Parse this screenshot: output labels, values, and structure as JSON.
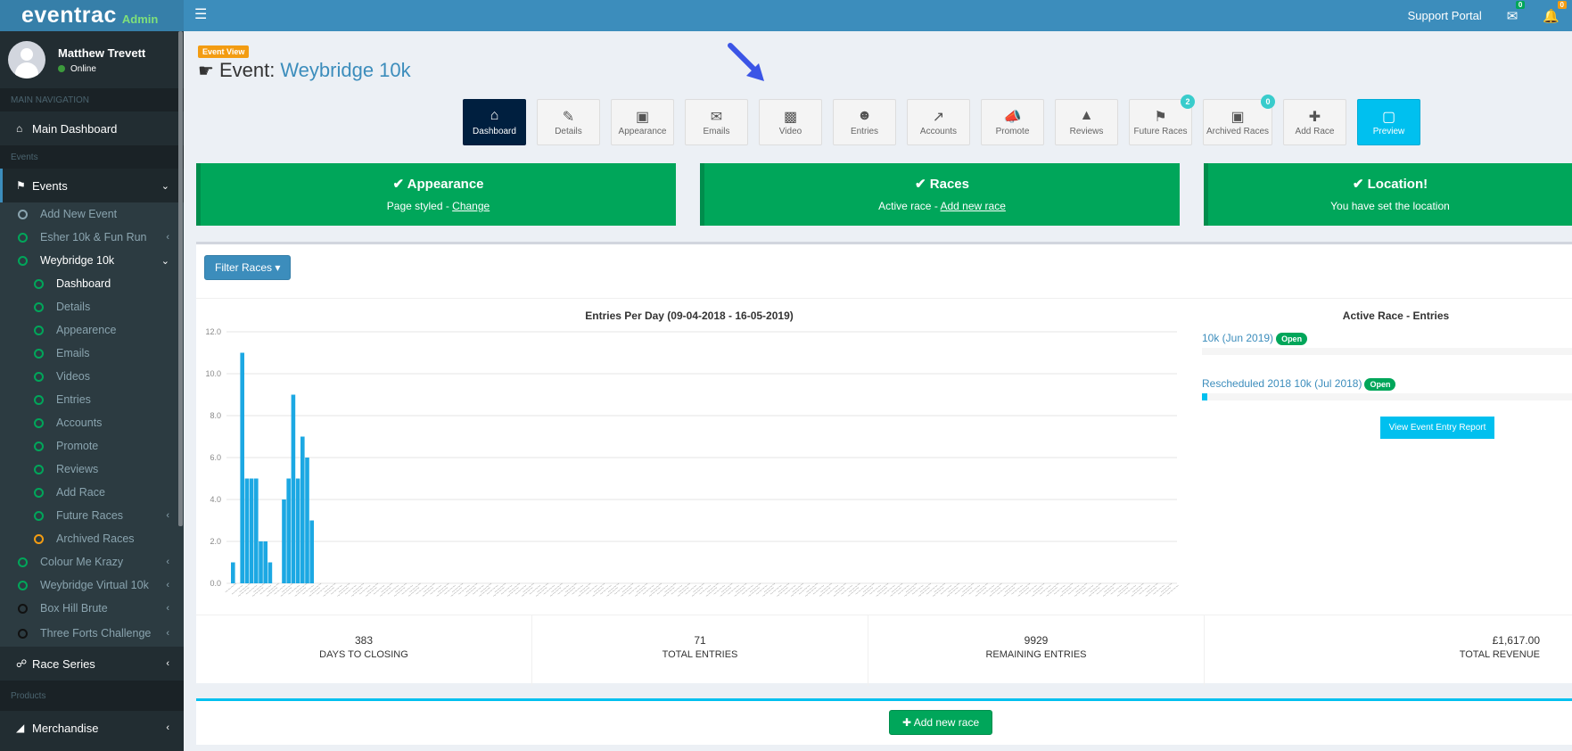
{
  "topbar": {
    "brand": "eventrac",
    "brand_suffix": "Admin",
    "menu_icon": "hamburger-icon",
    "support_label": "Support Portal",
    "messages_count": "0",
    "notifications_count": "0",
    "colors": {
      "topbar": "#3c8dbc",
      "msg_badge": "#00a65a",
      "notif_badge": "#f39c12"
    }
  },
  "user": {
    "name": "Matthew Trevett",
    "status": "Online"
  },
  "sidebar": {
    "main_nav_header": "MAIN NAVIGATION",
    "main_dashboard": "Main Dashboard",
    "events_header": "Events",
    "events": "Events",
    "add_new_event": "Add New Event",
    "event_items": [
      {
        "label": "Esher 10k & Fun Run",
        "status": "green"
      },
      {
        "label": "Weybridge 10k",
        "status": "green"
      }
    ],
    "weybridge_sub": [
      {
        "label": "Dashboard",
        "ring": "green"
      },
      {
        "label": "Details",
        "ring": "green"
      },
      {
        "label": "Appearence",
        "ring": "green"
      },
      {
        "label": "Emails",
        "ring": "green"
      },
      {
        "label": "Videos",
        "ring": "green"
      },
      {
        "label": "Entries",
        "ring": "green"
      },
      {
        "label": "Accounts",
        "ring": "green"
      },
      {
        "label": "Promote",
        "ring": "green"
      },
      {
        "label": "Reviews",
        "ring": "green"
      },
      {
        "label": "Add Race",
        "ring": "green"
      },
      {
        "label": "Future Races",
        "ring": "green"
      },
      {
        "label": "Archived Races",
        "ring": "orange"
      }
    ],
    "other_events": [
      {
        "label": "Colour Me Krazy",
        "ring": "green"
      },
      {
        "label": "Weybridge Virtual 10k",
        "ring": "green"
      },
      {
        "label": "Box Hill Brute",
        "ring": "black"
      },
      {
        "label": "Three Forts Challenge",
        "ring": "black"
      }
    ],
    "race_series": "Race Series",
    "products_header": "Products",
    "merchandise": "Merchandise"
  },
  "page": {
    "badge": "Event View",
    "title_prefix": "Event:",
    "event_name": "Weybridge 10k"
  },
  "toolbar": [
    {
      "label": "Dashboard",
      "icon": "home-icon"
    },
    {
      "label": "Details",
      "icon": "edit-icon"
    },
    {
      "label": "Appearance",
      "icon": "image-icon"
    },
    {
      "label": "Emails",
      "icon": "envelope-icon"
    },
    {
      "label": "Video",
      "icon": "video-camera-icon"
    },
    {
      "label": "Entries",
      "icon": "users-icon"
    },
    {
      "label": "Accounts",
      "icon": "line-chart-icon"
    },
    {
      "label": "Promote",
      "icon": "bullhorn-icon"
    },
    {
      "label": "Reviews",
      "icon": "area-chart-icon"
    },
    {
      "label": "Future Races",
      "icon": "flag-icon",
      "badge": "2"
    },
    {
      "label": "Archived Races",
      "icon": "archive-icon",
      "badge": "0"
    },
    {
      "label": "Add Race",
      "icon": "plus-icon"
    },
    {
      "label": "Preview",
      "icon": "desktop-icon"
    }
  ],
  "status_cards": [
    {
      "title": "Appearance",
      "text": "Page styled - ",
      "link": "Change"
    },
    {
      "title": "Races",
      "text": "Active race - ",
      "link": "Add new race"
    },
    {
      "title": "Location!",
      "text": "You have set the location",
      "link": ""
    }
  ],
  "filter_button": "Filter Races",
  "chart_data": {
    "type": "bar",
    "title": "Entries Per Day (09-04-2018 - 16-05-2019)",
    "xlabel": "",
    "ylabel": "",
    "ylim": [
      0,
      12
    ],
    "yticks": [
      "0.0",
      "2.0",
      "4.0",
      "6.0",
      "8.0",
      "10.0",
      "12.0"
    ],
    "grid": true,
    "categories_note": "daily dates 09-04-2018 to 16-05-2019 (rotated, illegible)",
    "values": [
      1,
      0,
      11,
      5,
      5,
      5,
      2,
      2,
      1,
      0,
      0,
      4,
      5,
      9,
      5,
      7,
      6,
      3
    ],
    "color": "#1ca8e3"
  },
  "active_races": {
    "title": "Active Race - Entries",
    "races": [
      {
        "name": "10k (Jun 2019)",
        "status": "Open",
        "progress": 0
      },
      {
        "name": "Rescheduled 2018 10k (Jul 2018)",
        "status": "Open",
        "progress": 0.01
      }
    ],
    "report_button": "View Event Entry Report"
  },
  "stats": [
    {
      "value": "383",
      "label": "DAYS TO CLOSING"
    },
    {
      "value": "71",
      "label": "TOTAL ENTRIES"
    },
    {
      "value": "9929",
      "label": "REMAINING ENTRIES"
    },
    {
      "value": "£1,617.00",
      "label": "TOTAL REVENUE"
    }
  ],
  "add_new_race_button": "Add new race"
}
